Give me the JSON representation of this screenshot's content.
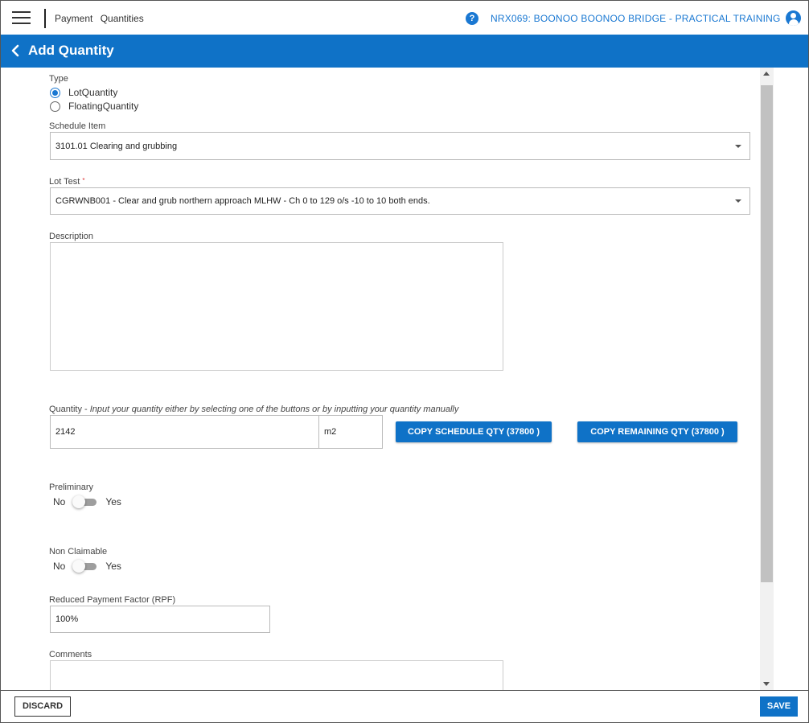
{
  "topbar": {
    "breadcrumb": [
      "Payment",
      "Quantities"
    ],
    "project": "NRX069: BOONOO BOONOO BRIDGE - PRACTICAL TRAINING",
    "help_glyph": "?"
  },
  "header": {
    "title": "Add Quantity"
  },
  "form": {
    "type_label": "Type",
    "type_options": [
      {
        "label": "LotQuantity",
        "selected": true
      },
      {
        "label": "FloatingQuantity",
        "selected": false
      }
    ],
    "schedule_item_label": "Schedule Item",
    "schedule_item_value": "3101.01 Clearing and grubbing",
    "lot_test_label": "Lot Test",
    "lot_test_required_mark": "*",
    "lot_test_value": "CGRWNB001 - Clear and grub northern approach MLHW - Ch 0 to 129  o/s -10 to 10 both ends.",
    "description_label": "Description",
    "description_value": "",
    "quantity_label": "Quantity - ",
    "quantity_hint": "Input your quantity either by selecting one of the buttons or by inputting your quantity manually",
    "quantity_value": "2142",
    "quantity_unit": "m2",
    "copy_schedule_label": "COPY SCHEDULE QTY (37800 )",
    "copy_remaining_label": "COPY REMAINING QTY (37800 )",
    "preliminary_label": "Preliminary",
    "preliminary_value": false,
    "non_claimable_label": "Non Claimable",
    "non_claimable_value": false,
    "toggle_off_label": "No",
    "toggle_on_label": "Yes",
    "rpf_label": "Reduced Payment Factor (RPF)",
    "rpf_value": "100%",
    "comments_label": "Comments",
    "comments_value": ""
  },
  "footer": {
    "discard_label": "DISCARD",
    "save_label": "SAVE"
  },
  "colors": {
    "accent": "#0f72c7",
    "scroll_thumb": "#c1c1c1"
  },
  "icons": {
    "menu": "hamburger-icon",
    "help": "help-icon",
    "user": "user-icon",
    "back": "chevron-left-icon"
  }
}
